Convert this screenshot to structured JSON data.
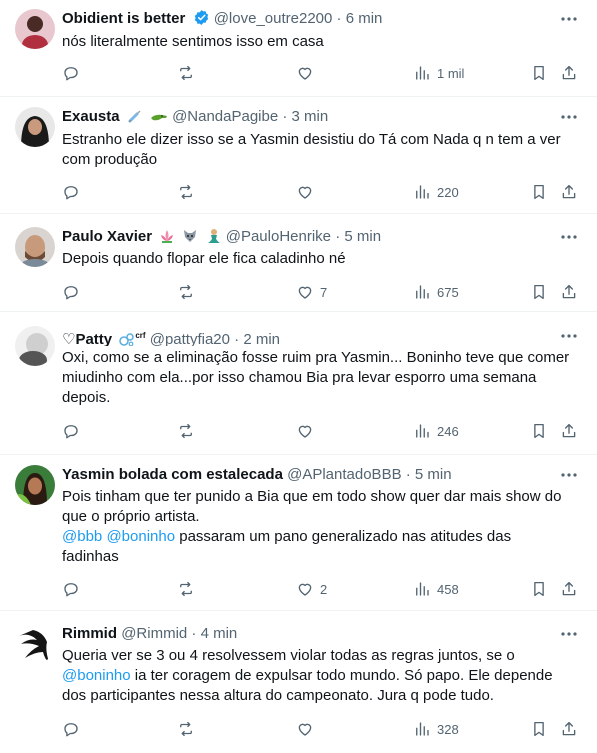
{
  "colors": {
    "text": "#0f1419",
    "secondary": "#536471",
    "link": "#1d9bf0",
    "divider": "#eff3f4",
    "verified": "#1d9bf0"
  },
  "tweets": [
    {
      "name": "Obidient is better",
      "verified": true,
      "handle": "@love_outre2200",
      "separator": "·",
      "time": "6 min",
      "text": "nós literalmente sentimos isso em casa",
      "replies": "",
      "retweets": "",
      "likes": "",
      "views": "1 mil"
    },
    {
      "name": "Exausta",
      "name_emojis": [
        "syringe-emoji",
        "crocodile-emoji"
      ],
      "handle": "@NandaPagibe",
      "separator": "·",
      "time": "3 min",
      "text_line1": "Estranho ele dizer isso se a Yasmin desistiu do Tá com Nada q n tem a ver",
      "text_line2": "com produção",
      "replies": "",
      "retweets": "",
      "likes": "",
      "views": "220"
    },
    {
      "name": "Paulo Xavier",
      "name_emojis": [
        "lotus-emoji",
        "wolf-emoji",
        "mermaid-emoji"
      ],
      "handle": "@PauloHenrike",
      "separator": "·",
      "time": "5 min",
      "text": "Depois quando flopar ele fica caladinho né",
      "replies": "",
      "retweets": "",
      "likes": "7",
      "views": "675"
    },
    {
      "name": "♡Patty",
      "name_emojis": [
        "bubbles-emoji"
      ],
      "name_suffix": "crf",
      "handle": "@pattyfia20",
      "separator": "·",
      "time": "2 min",
      "text_line1": "Oxi, como se a eliminação fosse ruim pra Yasmin... Boninho teve que comer",
      "text_line2": "miudinho com ela...por isso chamou Bia pra levar esporro uma semana",
      "text_line3": "depois.",
      "replies": "",
      "retweets": "",
      "likes": "",
      "views": "246"
    },
    {
      "name": "Yasmin bolada com estalecada",
      "handle": "@APlantadoBBB",
      "separator": "·",
      "time": "5 min",
      "text_line1": "Pois tinham que ter punido a Bia que em todo show quer dar mais show do",
      "text_line2": "que o próprio artista.",
      "mention1": "@bbb",
      "mention2": "@boninho",
      "text_line3_rest": " passaram um pano generalizado nas atitudes das",
      "text_line4": "fadinhas",
      "replies": "",
      "retweets": "",
      "likes": "2",
      "views": "458"
    },
    {
      "name": "Rimmid",
      "handle": "@Rimmid",
      "separator": "·",
      "time": "4 min",
      "text_line1": "Queria ver se 3 ou 4 resolvessem violar todas as regras juntos, se o",
      "mention": "@boninho",
      "text_line2_rest": " ia ter coragem de expulsar todo mundo. Só papo. Ele depende",
      "text_line3": "dos participantes nessa altura do campeonato. Jura q pode tudo.",
      "replies": "",
      "retweets": "",
      "likes": "",
      "views": "328"
    }
  ]
}
